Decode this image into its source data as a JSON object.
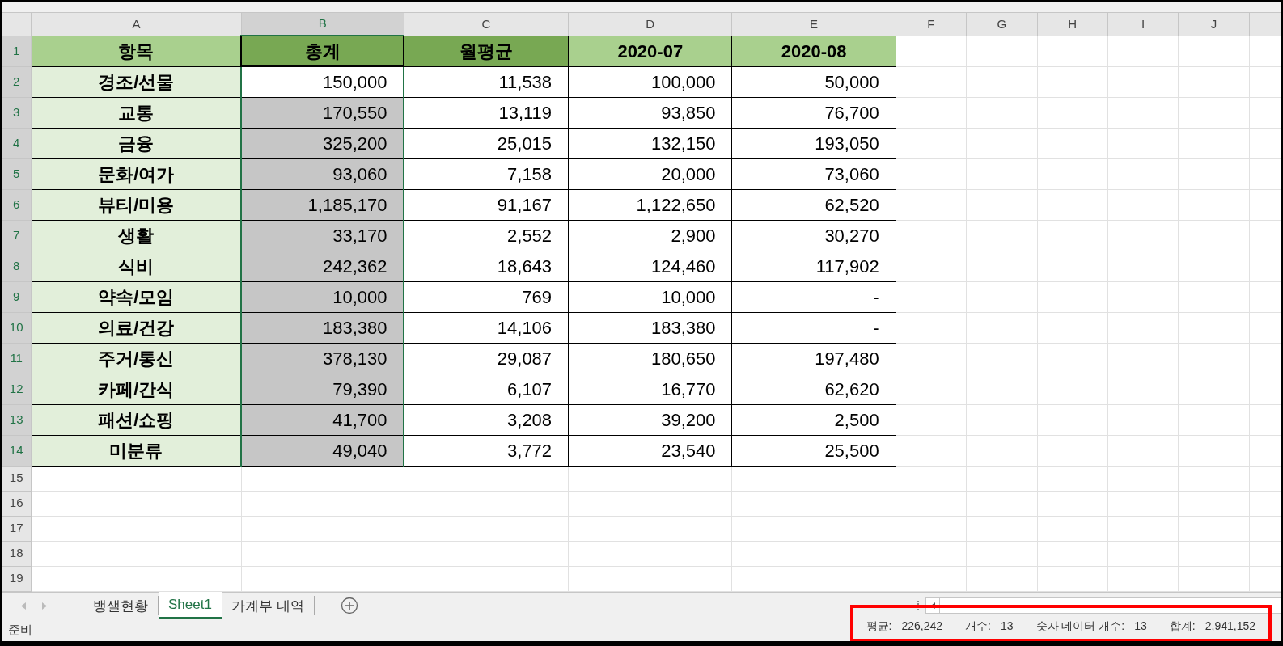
{
  "columns": [
    {
      "label": "A",
      "selected": false
    },
    {
      "label": "B",
      "selected": true
    },
    {
      "label": "C",
      "selected": false
    },
    {
      "label": "D",
      "selected": false
    },
    {
      "label": "E",
      "selected": false
    },
    {
      "label": "F",
      "selected": false
    },
    {
      "label": "G",
      "selected": false
    },
    {
      "label": "H",
      "selected": false
    },
    {
      "label": "I",
      "selected": false
    },
    {
      "label": "J",
      "selected": false
    }
  ],
  "header_row": {
    "number": "1",
    "selected": true,
    "cells": [
      {
        "text": "항목",
        "color": "#a9d08e"
      },
      {
        "text": "총계",
        "color": "#78a853"
      },
      {
        "text": "월평균",
        "color": "#78a853"
      },
      {
        "text": "2020-07",
        "color": "#a9d08e"
      },
      {
        "text": "2020-08",
        "color": "#a9d08e"
      }
    ]
  },
  "rows": [
    {
      "number": "2",
      "selected": true,
      "cursor": true,
      "cells": [
        "경조/선물",
        "150,000",
        "11,538",
        "100,000",
        "50,000"
      ]
    },
    {
      "number": "3",
      "selected": true,
      "cursor": false,
      "cells": [
        "교통",
        "170,550",
        "13,119",
        "93,850",
        "76,700"
      ]
    },
    {
      "number": "4",
      "selected": true,
      "cursor": false,
      "cells": [
        "금융",
        "325,200",
        "25,015",
        "132,150",
        "193,050"
      ]
    },
    {
      "number": "5",
      "selected": true,
      "cursor": false,
      "cells": [
        "문화/여가",
        "93,060",
        "7,158",
        "20,000",
        "73,060"
      ]
    },
    {
      "number": "6",
      "selected": true,
      "cursor": false,
      "cells": [
        "뷰티/미용",
        "1,185,170",
        "91,167",
        "1,122,650",
        "62,520"
      ]
    },
    {
      "number": "7",
      "selected": true,
      "cursor": false,
      "cells": [
        "생활",
        "33,170",
        "2,552",
        "2,900",
        "30,270"
      ]
    },
    {
      "number": "8",
      "selected": true,
      "cursor": false,
      "cells": [
        "식비",
        "242,362",
        "18,643",
        "124,460",
        "117,902"
      ]
    },
    {
      "number": "9",
      "selected": true,
      "cursor": false,
      "cells": [
        "약속/모임",
        "10,000",
        "769",
        "10,000",
        "-"
      ]
    },
    {
      "number": "10",
      "selected": true,
      "cursor": false,
      "cells": [
        "의료/건강",
        "183,380",
        "14,106",
        "183,380",
        "-"
      ]
    },
    {
      "number": "11",
      "selected": true,
      "cursor": false,
      "cells": [
        "주거/통신",
        "378,130",
        "29,087",
        "180,650",
        "197,480"
      ]
    },
    {
      "number": "12",
      "selected": true,
      "cursor": false,
      "cells": [
        "카페/간식",
        "79,390",
        "6,107",
        "16,770",
        "62,620"
      ]
    },
    {
      "number": "13",
      "selected": true,
      "cursor": false,
      "cells": [
        "패션/쇼핑",
        "41,700",
        "3,208",
        "39,200",
        "2,500"
      ]
    },
    {
      "number": "14",
      "selected": true,
      "cursor": false,
      "cells": [
        "미분류",
        "49,040",
        "3,772",
        "23,540",
        "25,500"
      ]
    }
  ],
  "empty_rows": [
    "15",
    "16",
    "17",
    "18",
    "19"
  ],
  "sheet_tabs": [
    {
      "label": "뱅샐현황",
      "selected": false
    },
    {
      "label": "Sheet1",
      "selected": true
    },
    {
      "label": "가계부 내역",
      "selected": false
    }
  ],
  "status_bar": {
    "mode": "준비",
    "stats": [
      {
        "label": "평균:",
        "value": "226,242"
      },
      {
        "label": "개수:",
        "value": "13"
      },
      {
        "label": "숫자 데이터 개수:",
        "value": "13"
      },
      {
        "label": "합계:",
        "value": "2,941,152"
      }
    ]
  }
}
